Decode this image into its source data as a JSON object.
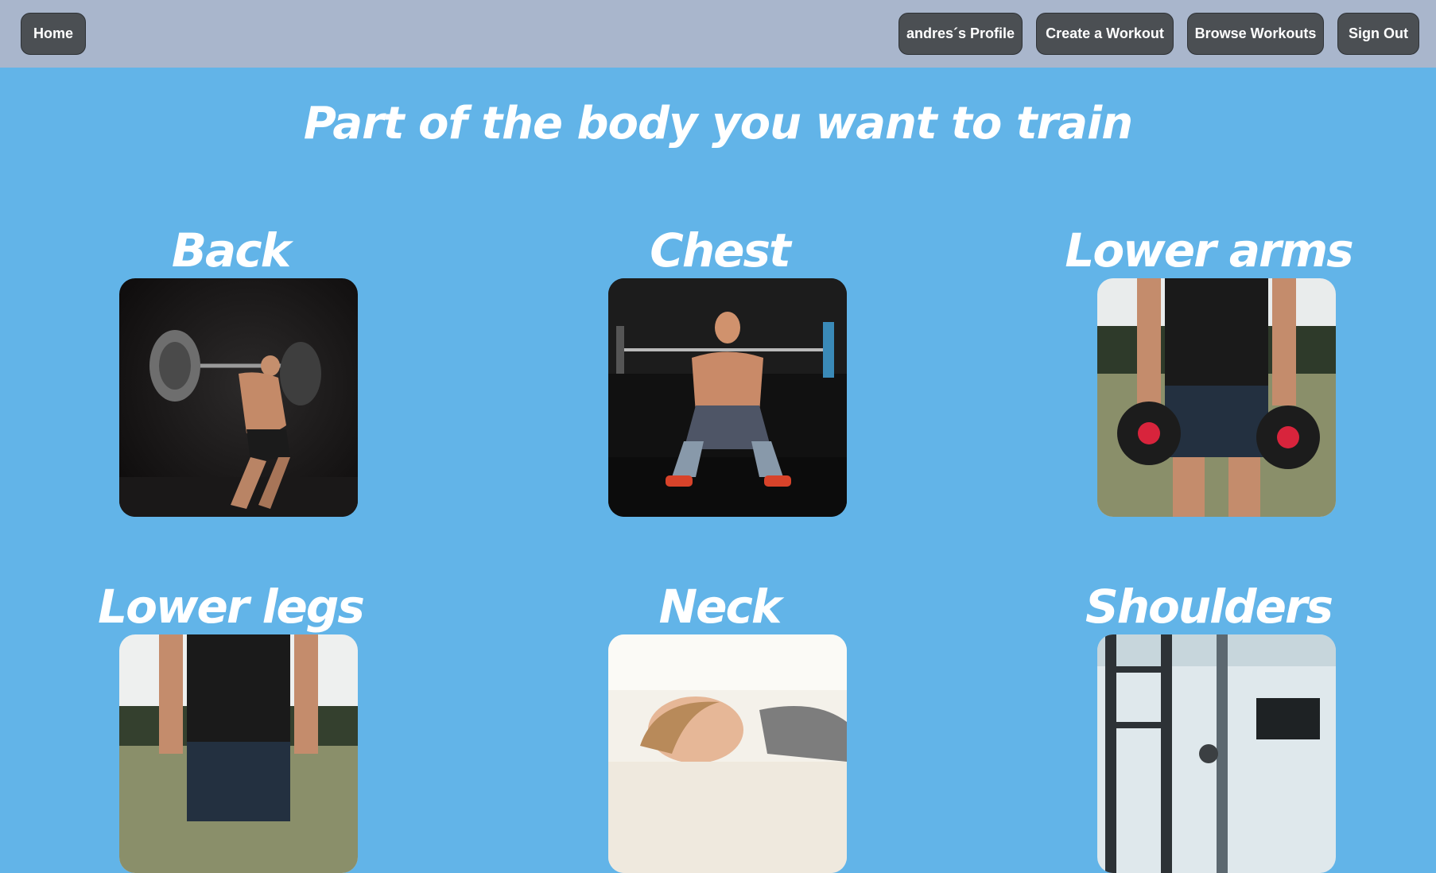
{
  "nav": {
    "home": "Home",
    "profile": "andres´s Profile",
    "create_workout": "Create a Workout",
    "browse_workouts": "Browse Workouts",
    "sign_out": "Sign Out"
  },
  "page": {
    "title": "Part of the body you want to train"
  },
  "body_parts": [
    {
      "label": "Back",
      "image": "squat-back-photo"
    },
    {
      "label": "Chest",
      "image": "front-squat-photo"
    },
    {
      "label": "Lower arms",
      "image": "kettlebell-carry-photo"
    },
    {
      "label": "Lower legs",
      "image": "standing-legs-photo"
    },
    {
      "label": "Neck",
      "image": "woman-lying-photo"
    },
    {
      "label": "Shoulders",
      "image": "gym-interior-photo"
    }
  ],
  "colors": {
    "page_background": "#62b4e8",
    "navbar_background": "#a9b6cc",
    "button_background": "#4b4f53",
    "text": "#ffffff"
  }
}
